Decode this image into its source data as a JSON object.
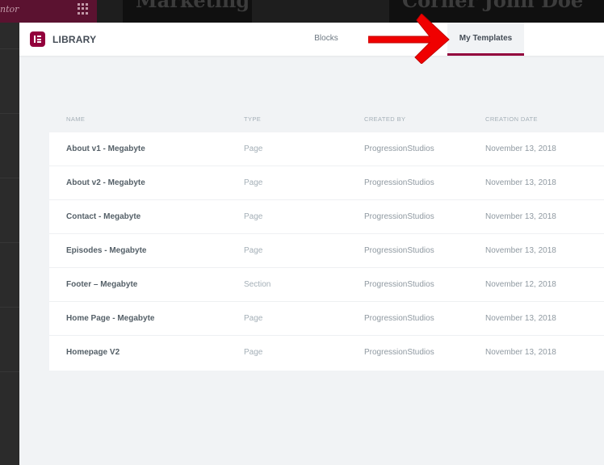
{
  "background": {
    "topbar_text": "ntor",
    "hero_texts": [
      "Marketing",
      "Corner John Doe"
    ]
  },
  "header": {
    "title": "LIBRARY",
    "tabs": [
      {
        "label": "Blocks",
        "active": false
      },
      {
        "label": "My Templates",
        "active": true
      }
    ]
  },
  "colors": {
    "accent": "#93003c",
    "annotation_arrow": "#f00000"
  },
  "table": {
    "columns": [
      "NAME",
      "TYPE",
      "CREATED BY",
      "CREATION DATE"
    ],
    "rows": [
      {
        "name": "About v1 - Megabyte",
        "type": "Page",
        "created_by": "ProgressionStudios",
        "date": "November 13, 2018"
      },
      {
        "name": "About v2 - Megabyte",
        "type": "Page",
        "created_by": "ProgressionStudios",
        "date": "November 13, 2018"
      },
      {
        "name": "Contact - Megabyte",
        "type": "Page",
        "created_by": "ProgressionStudios",
        "date": "November 13, 2018"
      },
      {
        "name": "Episodes - Megabyte",
        "type": "Page",
        "created_by": "ProgressionStudios",
        "date": "November 13, 2018"
      },
      {
        "name": "Footer – Megabyte",
        "type": "Section",
        "created_by": "ProgressionStudios",
        "date": "November 12, 2018"
      },
      {
        "name": "Home Page - Megabyte",
        "type": "Page",
        "created_by": "ProgressionStudios",
        "date": "November 13, 2018"
      },
      {
        "name": "Homepage V2",
        "type": "Page",
        "created_by": "ProgressionStudios",
        "date": "November 13, 2018"
      }
    ]
  }
}
